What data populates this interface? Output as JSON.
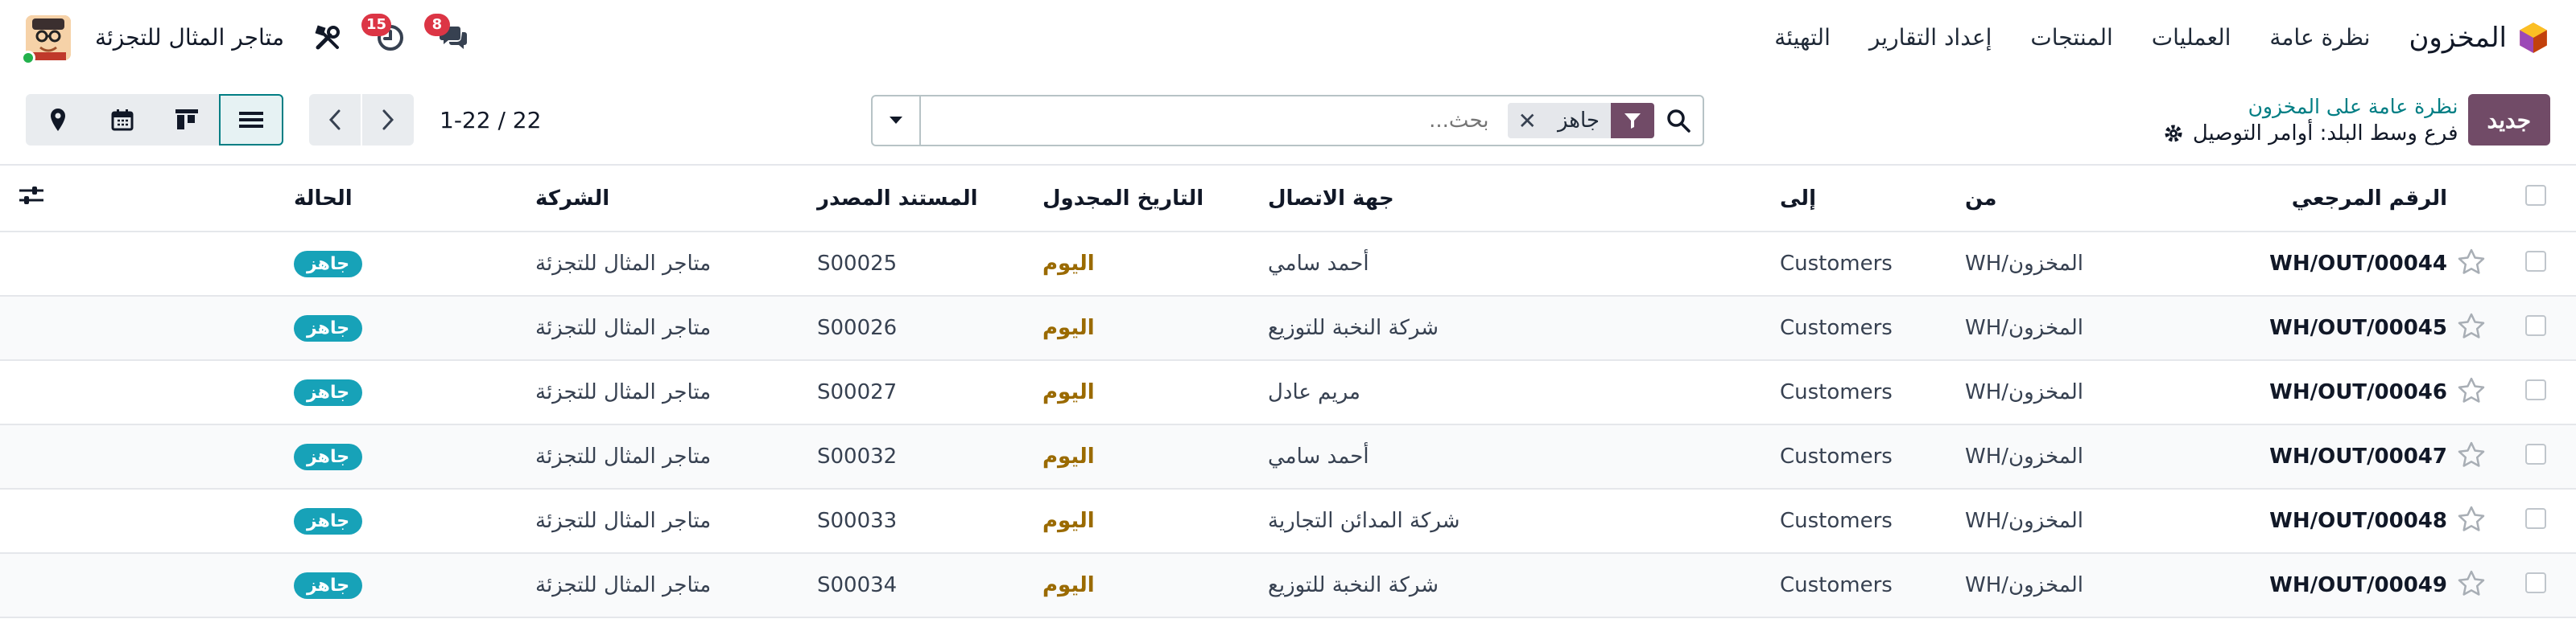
{
  "navbar": {
    "app_name": "المخزون",
    "menu": [
      "نظرة عامة",
      "العمليات",
      "المنتجات",
      "إعداد التقارير",
      "التهيئة"
    ],
    "company_name": "متاجر المثال للتجزئة",
    "messages_count": "8",
    "activities_count": "15"
  },
  "control": {
    "new_label": "جديد",
    "breadcrumb_parent": "نظرة عامة على المخزون",
    "breadcrumb_current": "فرع وسط البلد: أوامر التوصيل",
    "search": {
      "facet_label": "جاهز",
      "placeholder": "بحث..."
    },
    "pager": "1-22 / 22"
  },
  "table": {
    "columns": [
      "الرقم المرجعي",
      "من",
      "إلى",
      "جهة الاتصال",
      "التاريخ المجدول",
      "المستند المصدر",
      "الشركة",
      "الحالة"
    ],
    "rows": [
      {
        "ref": "WH/OUT/00044",
        "from": "WH/المخزون",
        "to": "Customers",
        "contact": "أحمد سامي",
        "date": "اليوم",
        "source": "S00025",
        "company": "متاجر المثال للتجزئة",
        "state": "جاهز"
      },
      {
        "ref": "WH/OUT/00045",
        "from": "WH/المخزون",
        "to": "Customers",
        "contact": "شركة النخبة للتوزيع",
        "date": "اليوم",
        "source": "S00026",
        "company": "متاجر المثال للتجزئة",
        "state": "جاهز"
      },
      {
        "ref": "WH/OUT/00046",
        "from": "WH/المخزون",
        "to": "Customers",
        "contact": "مريم عادل",
        "date": "اليوم",
        "source": "S00027",
        "company": "متاجر المثال للتجزئة",
        "state": "جاهز"
      },
      {
        "ref": "WH/OUT/00047",
        "from": "WH/المخزون",
        "to": "Customers",
        "contact": "أحمد سامي",
        "date": "اليوم",
        "source": "S00032",
        "company": "متاجر المثال للتجزئة",
        "state": "جاهز"
      },
      {
        "ref": "WH/OUT/00048",
        "from": "WH/المخزون",
        "to": "Customers",
        "contact": "شركة المدائن التجارية",
        "date": "اليوم",
        "source": "S00033",
        "company": "متاجر المثال للتجزئة",
        "state": "جاهز"
      },
      {
        "ref": "WH/OUT/00049",
        "from": "WH/المخزون",
        "to": "Customers",
        "contact": "شركة النخبة للتوزيع",
        "date": "اليوم",
        "source": "S00034",
        "company": "متاجر المثال للتجزئة",
        "state": "جاهز"
      }
    ]
  },
  "colors": {
    "brand": "#714b67",
    "accent": "#017e84",
    "status_ready": "#17a2b8",
    "badge": "#dc3545"
  },
  "icons": [
    "inventory-app-icon",
    "chat-icon",
    "clock-icon",
    "tools-icon",
    "search-icon",
    "filter-icon",
    "gear-icon",
    "list-view-icon",
    "kanban-view-icon",
    "calendar-view-icon",
    "map-view-icon",
    "chevron-left-icon",
    "chevron-right-icon",
    "star-icon",
    "column-settings-icon"
  ]
}
